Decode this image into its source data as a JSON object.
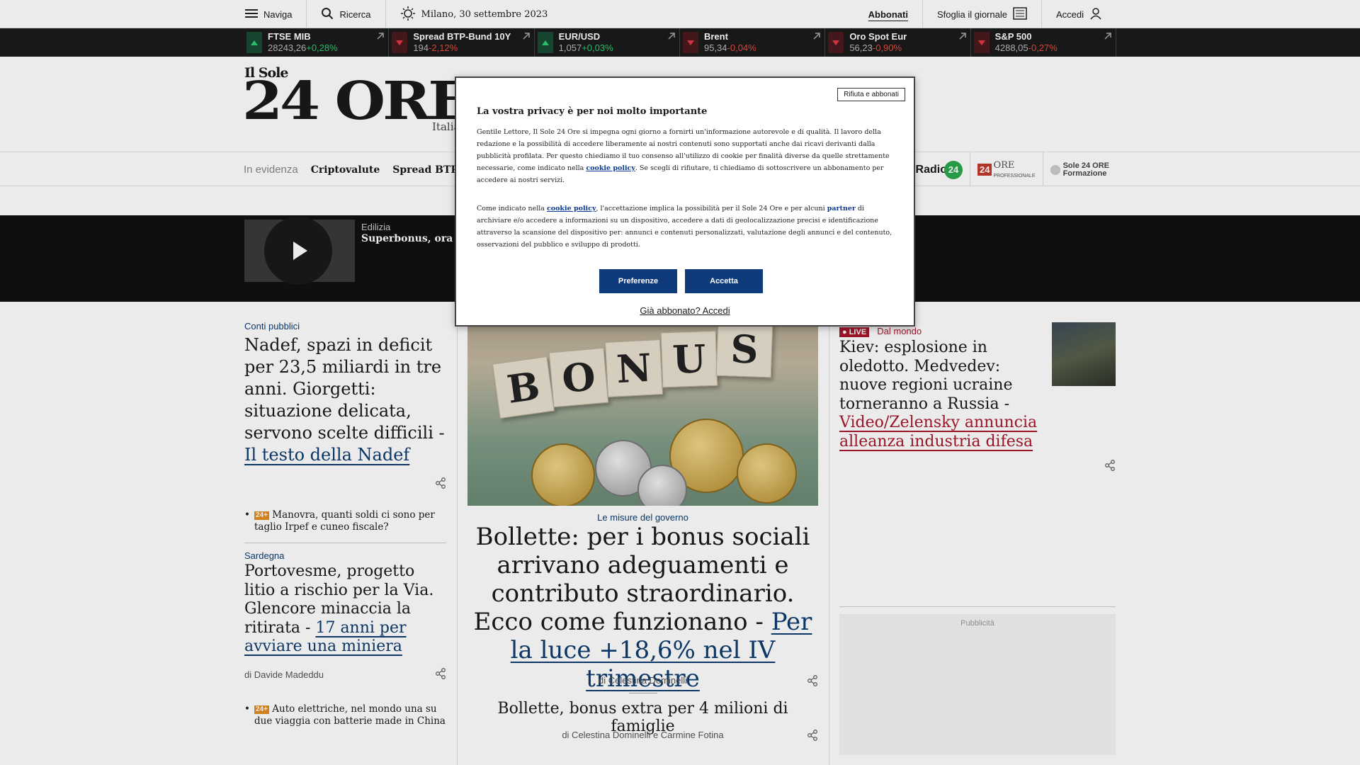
{
  "topbar": {
    "menu_label": "Naviga",
    "search_label": "Ricerca",
    "weather_text": "Milano, 30 settembre 2023",
    "subscribe_label": "Abbonati",
    "newspaper_label": "Sfoglia il giornale",
    "login_label": "Accedi"
  },
  "ticker": [
    {
      "name": "FTSE MIB",
      "value": "28243,26",
      "change": "+0,28%",
      "dir": "up"
    },
    {
      "name": "Spread BTP-Bund 10Y",
      "value": "194",
      "change": "-2,12%",
      "dir": "down"
    },
    {
      "name": "EUR/USD",
      "value": "1,057",
      "change": "+0,03%",
      "dir": "up"
    },
    {
      "name": "Brent",
      "value": "95,34",
      "change": "-0,04%",
      "dir": "down"
    },
    {
      "name": "Oro Spot Eur",
      "value": "56,23",
      "change": "-0,90%",
      "dir": "down"
    },
    {
      "name": "S&P 500",
      "value": "4288,05",
      "change": "-0,27%",
      "dir": "down"
    }
  ],
  "header": {
    "logo_top": "Il Sole",
    "logo_main": "24 ORE",
    "section_label": "Italia"
  },
  "nav": {
    "in_evidenza": "In evidenza",
    "links": [
      "Criptovalute",
      "Spread BTP-Bund"
    ],
    "partners": {
      "radio": "Radio",
      "radio_num": "24",
      "pro_num": "24",
      "pro_name": "ORE",
      "pro_sub": "PROFESSIONALE",
      "formazione_top": "Sole 24 ORE",
      "formazione_bottom": "Formazione"
    }
  },
  "video": {
    "category": "Edilizia",
    "title": "Superbonus, ora le"
  },
  "left": {
    "a1": {
      "kicker": "Conti pubblici",
      "title": "Nadef, spazi in deficit per 23,5 miliardi in tre anni. Giorgetti: situazione delicata, servono scelte difficili - ",
      "link": "Il testo della Nadef"
    },
    "b1": {
      "badge": "24+",
      "text": "Manovra, quanti soldi ci sono per taglio Irpef e cuneo fiscale?"
    },
    "a2": {
      "kicker": "Sardegna",
      "title": "Portovesme, progetto litio a rischio per la Via. Glencore minaccia la ritirata - ",
      "link": "17 anni per avviare una miniera",
      "byline": "di Davide Madeddu"
    },
    "b2": {
      "badge": "24+",
      "text": "Auto elettriche, nel mondo una su due viaggia con batterie made in China"
    }
  },
  "center": {
    "cube_letters": [
      "B",
      "O",
      "N",
      "U",
      "S"
    ],
    "kicker": "Le misure del governo",
    "title": "Bollette: per i bonus sociali arrivano adeguamenti e contributo straordinario. Ecco come funzionano - ",
    "link": "Per la luce +18,6% nel IV trimestre",
    "byline": "di Celestina Dominelli",
    "sub_title": "Bollette, bonus extra per 4 milioni di famiglie",
    "sub_byline": "di Celestina Dominelli e Carmine Fotina"
  },
  "right": {
    "live": "LIVE",
    "kicker": "Dal mondo",
    "title": "Kiev: esplosione in oledotto. Medvedev: nuove regioni ucraine torneranno a Russia - ",
    "link": "Video/Zelensky annuncia alleanza industria difesa",
    "ad_label": "Pubblicità"
  },
  "modal": {
    "reject_label": "Rifiuta e abbonati",
    "title": "La vostra privacy è per noi molto importante",
    "p1_a": "Gentile Lettore, Il Sole 24 Ore si impegna ogni giorno a fornirti un'informazione autorevole e di qualità. Il lavoro della redazione e la possibilità di accedere liberamente ai nostri contenuti sono supportati anche dai ricavi derivanti dalla pubblicità profilata. Per questo chiediamo il tuo consenso all'utilizzo di cookie per finalità diverse da quelle strettamente necessarie, come indicato nella ",
    "cookie_link": "cookie policy",
    "p1_b": ". Se scegli di rifiutare, ti chiediamo di sottoscrivere un abbonamento per accedere ai nostri servizi.",
    "p2_a": "Come indicato nella ",
    "p2_b": ", l'accettazione implica la possibilità per il Sole 24 Ore e per alcuni ",
    "partner_link": "partner",
    "p2_c": " di archiviare e/o accedere a informazioni su un dispositivo, accedere a dati di geolocalizzazione precisi e identificazione attraverso la scansione del dispositivo per: annunci e contenuti personalizzati, valutazione degli annunci e del contenuto, osservazioni del pubblico e sviluppo di prodotti.",
    "pref_label": "Preferenze",
    "accept_label": "Accetta",
    "login_link": "Già abbonato? Accedi"
  }
}
